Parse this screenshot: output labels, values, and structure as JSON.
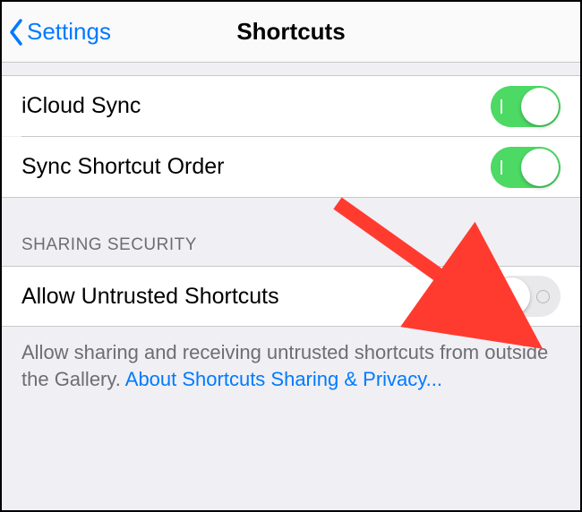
{
  "nav": {
    "back_label": "Settings",
    "title": "Shortcuts"
  },
  "rows": {
    "icloud_sync": {
      "label": "iCloud Sync",
      "on": true
    },
    "sync_order": {
      "label": "Sync Shortcut Order",
      "on": true
    },
    "allow_untrusted": {
      "label": "Allow Untrusted Shortcuts",
      "on": false
    }
  },
  "section_header": "SHARING SECURITY",
  "footer": {
    "text": "Allow sharing and receiving untrusted shortcuts from outside the Gallery. ",
    "link": "About Shortcuts Sharing & Privacy..."
  },
  "colors": {
    "tint": "#007aff",
    "toggle_on": "#4cd964",
    "arrow": "#ff3b30"
  }
}
